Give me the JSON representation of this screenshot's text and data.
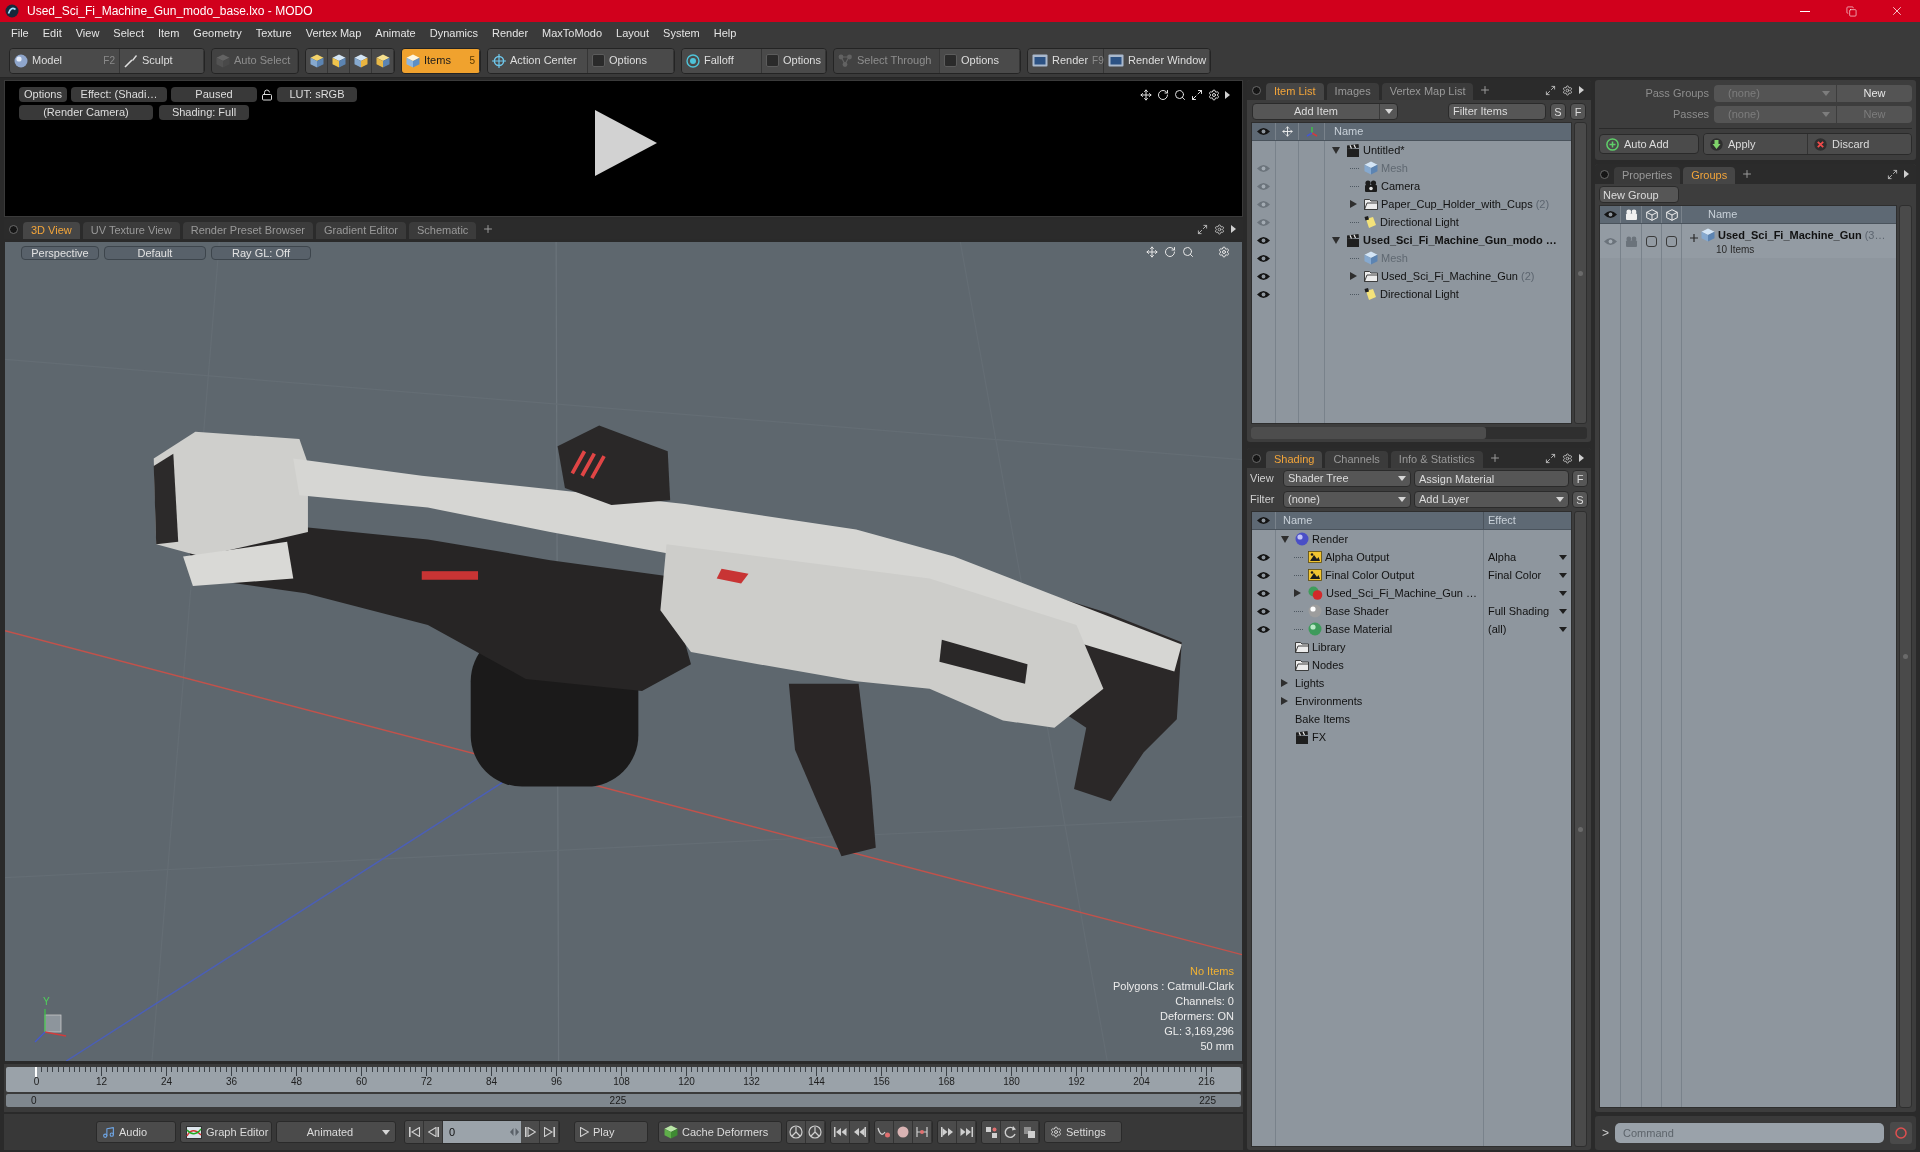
{
  "window": {
    "title": "Used_Sci_Fi_Machine_Gun_modo_base.lxo - MODO"
  },
  "menu": [
    "File",
    "Edit",
    "View",
    "Select",
    "Item",
    "Geometry",
    "Texture",
    "Vertex Map",
    "Animate",
    "Dynamics",
    "Render",
    "MaxToModo",
    "Layout",
    "System",
    "Help"
  ],
  "toolbar": [
    {
      "items": [
        {
          "kind": "tool",
          "label": "Model",
          "shortcut": "F2",
          "selected": false,
          "disabled": false
        },
        {
          "kind": "tool",
          "label": "Sculpt",
          "selected": false,
          "disabled": false
        }
      ]
    },
    {
      "items": [
        {
          "kind": "tool",
          "label": "Auto Select",
          "selected": false,
          "disabled": true
        }
      ]
    },
    {
      "items": [
        {
          "kind": "icon",
          "selected": false,
          "disabled": false
        },
        {
          "kind": "icon",
          "selected": false,
          "disabled": false
        },
        {
          "kind": "icon",
          "selected": false,
          "disabled": false
        },
        {
          "kind": "icon",
          "selected": false,
          "disabled": false
        }
      ]
    },
    {
      "items": [
        {
          "kind": "tool",
          "label": "Items",
          "shortcut": "5",
          "selected": true,
          "disabled": false
        }
      ]
    },
    {
      "items": [
        {
          "kind": "tool",
          "label": "Action Center",
          "selected": false,
          "disabled": false
        },
        {
          "kind": "tool",
          "label": "Options",
          "selected": false,
          "disabled": false
        }
      ]
    },
    {
      "items": [
        {
          "kind": "tool",
          "label": "Falloff",
          "selected": false,
          "disabled": false
        },
        {
          "kind": "tool",
          "label": "Options",
          "selected": false,
          "disabled": false
        }
      ]
    },
    {
      "items": [
        {
          "kind": "tool",
          "label": "Select Through",
          "selected": false,
          "disabled": true
        },
        {
          "kind": "tool",
          "label": "Options",
          "selected": false,
          "disabled": false
        }
      ]
    },
    {
      "items": [
        {
          "kind": "tool",
          "label": "Render",
          "shortcut": "F9",
          "selected": false,
          "disabled": false
        },
        {
          "kind": "tool",
          "label": "Render Window",
          "selected": false,
          "disabled": false
        }
      ]
    }
  ],
  "render_preview": {
    "controls": [
      {
        "kind": "button",
        "label": "Options"
      },
      {
        "kind": "button",
        "label": "Effect: (Shadi…"
      },
      {
        "kind": "button",
        "label": "Paused"
      },
      {
        "kind": "lock"
      },
      {
        "kind": "button",
        "label": "LUT: sRGB"
      }
    ],
    "controls_row2": [
      "(Render Camera)",
      "Shading: Full"
    ]
  },
  "viewport": {
    "tabs": [
      {
        "label": "3D View",
        "selected": true
      },
      {
        "label": "UV Texture View",
        "selected": false
      },
      {
        "label": "Render Preset Browser",
        "selected": false
      },
      {
        "label": "Gradient Editor",
        "selected": false
      },
      {
        "label": "Schematic",
        "selected": false
      }
    ],
    "view_controls": [
      "Perspective",
      "Default",
      "Ray GL: Off"
    ],
    "axis_label": "Y",
    "stats": {
      "selection": "No Items",
      "lines": [
        "Polygons : Catmull-Clark",
        "Channels: 0",
        "Deformers: ON",
        "GL: 3,169,296",
        "50 mm"
      ]
    }
  },
  "timeline": {
    "ticks": [
      "0",
      "12",
      "24",
      "36",
      "48",
      "60",
      "72",
      "84",
      "96",
      "108",
      "120",
      "132",
      "144",
      "156",
      "168",
      "180",
      "192",
      "204",
      "216"
    ],
    "range_start": "0",
    "range_length": "225",
    "range_end": "225"
  },
  "bottom_bar": {
    "audio": "Audio",
    "graph_editor": "Graph Editor",
    "mode": "Animated",
    "frame": "0",
    "play": "Play",
    "cache": "Cache Deformers",
    "settings": "Settings"
  },
  "item_list": {
    "tabs": [
      {
        "label": "Item List",
        "selected": true
      },
      {
        "label": "Images",
        "selected": false
      },
      {
        "label": "Vertex Map List",
        "selected": false
      }
    ],
    "add_item": "Add Item",
    "filter_placeholder": "Filter Items",
    "buttons": [
      "S",
      "F"
    ],
    "column": "Name",
    "tree": [
      {
        "name": "Untitled*",
        "kind": "scene",
        "current": false,
        "expanded": true,
        "children": [
          {
            "name": "Mesh",
            "kind": "mesh",
            "eye_dimmed": true,
            "dimmed": true
          },
          {
            "name": "Camera",
            "kind": "camera",
            "eye_dimmed": true,
            "dimmed": false
          },
          {
            "name": "Paper_Cup_Holder_with_Cups",
            "count": "(2)",
            "kind": "group",
            "eye_dimmed": true,
            "dimmed": false,
            "expanded": false
          },
          {
            "name": "Directional Light",
            "kind": "light",
            "eye_dimmed": true,
            "dimmed": false
          }
        ]
      },
      {
        "name": "Used_Sci_Fi_Machine_Gun_modo …",
        "kind": "scene",
        "current": true,
        "eye_dimmed": false,
        "expanded": true,
        "children": [
          {
            "name": "Mesh",
            "kind": "mesh",
            "eye_dimmed": false,
            "dimmed": true
          },
          {
            "name": "Used_Sci_Fi_Machine_Gun",
            "count": "(2)",
            "kind": "group",
            "eye_dimmed": false,
            "dimmed": false,
            "expanded": false
          },
          {
            "name": "Directional Light",
            "kind": "light",
            "eye_dimmed": false,
            "dimmed": false
          }
        ]
      }
    ]
  },
  "shading": {
    "tabs": [
      {
        "label": "Shading",
        "selected": true
      },
      {
        "label": "Channels",
        "selected": false
      },
      {
        "label": "Info & Statistics",
        "selected": false
      }
    ],
    "view_label": "View",
    "view_value": "Shader Tree",
    "assign": "Assign Material",
    "filter_label": "Filter",
    "filter_value": "(none)",
    "add_layer": "Add Layer",
    "buttons": [
      "F",
      "S"
    ],
    "columns": [
      "Name",
      "Effect"
    ],
    "tree": [
      {
        "name": "Render",
        "kind": "render",
        "expanded": true,
        "children": [
          {
            "name": "Alpha Output",
            "kind": "output",
            "effect": "Alpha"
          },
          {
            "name": "Final Color Output",
            "kind": "output",
            "effect": "Final Color"
          },
          {
            "name": "Used_Sci_Fi_Machine_Gun …",
            "kind": "material_group",
            "expanded": false
          },
          {
            "name": "Base Shader",
            "kind": "shader",
            "effect": "Full Shading"
          },
          {
            "name": "Base Material",
            "kind": "material",
            "effect": "(all)"
          }
        ]
      },
      {
        "name": "Library",
        "kind": "folder"
      },
      {
        "name": "Nodes",
        "kind": "folder"
      },
      {
        "name": "Lights",
        "kind": "lights",
        "expanded": false
      },
      {
        "name": "Environments",
        "kind": "environments",
        "expanded": false
      },
      {
        "name": "Bake Items",
        "kind": "bake"
      },
      {
        "name": "FX",
        "kind": "fx"
      }
    ]
  },
  "passes": {
    "rows": [
      {
        "label": "Pass Groups",
        "value": "(none)",
        "value_disabled": true,
        "button": "New",
        "button_disabled": false
      },
      {
        "label": "Passes",
        "value": "(none)",
        "value_disabled": true,
        "button": "New",
        "button_disabled": true
      }
    ],
    "actions": [
      "Auto Add",
      "Apply",
      "Discard"
    ]
  },
  "groups": {
    "tabs": [
      {
        "label": "Properties",
        "selected": false
      },
      {
        "label": "Groups",
        "selected": true
      }
    ],
    "new_group": "New Group",
    "column": "Name",
    "rows": [
      {
        "name": "Used_Sci_Fi_Machine_Gun",
        "count": "(3…",
        "subtitle": "10 Items"
      }
    ]
  },
  "command": {
    "prompt": ">",
    "placeholder": "Command"
  }
}
